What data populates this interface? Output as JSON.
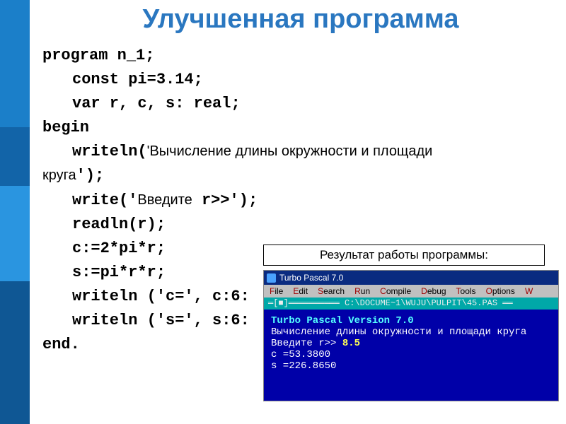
{
  "title": "Улучшенная программа",
  "code": {
    "l1_kw": "program",
    "l1_rest": " n_1;",
    "l2_kw": "const",
    "l2_rest": " pi=3.14;",
    "l3_kw": "var",
    "l3_rest": " r, c, s: real;",
    "l4_kw": "begin",
    "l5a": "writeln(",
    "l5b": "'Вычисление длины окружности и площади",
    "l6a": "круга",
    "l6b": "');",
    "l7a": "write('",
    "l7b": "Введите",
    "l7c": " r>>');",
    "l8": "readln(r);",
    "l9": "c:=2*pi*r;",
    "l10": "s:=pi*r*r;",
    "l11": "writeln ('c=', c:6:",
    "l12": "writeln ('s=', s:6:",
    "l13_kw": "end",
    "l13_rest": "."
  },
  "result_label": "Результат работы программы:",
  "screenshot": {
    "titlebar": "Turbo Pascal 7.0",
    "menu": {
      "file": "File",
      "edit": "Edit",
      "search": "Search",
      "run": "Run",
      "compile": "Compile",
      "debug": "Debug",
      "tools": "Tools",
      "options": "Options",
      "w": "W"
    },
    "path": "C:\\DOCUME~1\\WUJU\\PULPIT\\45.PAS",
    "out": {
      "l1a": "Turbo Pascal   Version 7.0",
      "l2": "Вычисление длины окружности и площади круга",
      "l3a": "Введите r>>",
      "l3b": " 8.5",
      "l4": "c =53.3800",
      "l5": "s =226.8650"
    }
  }
}
